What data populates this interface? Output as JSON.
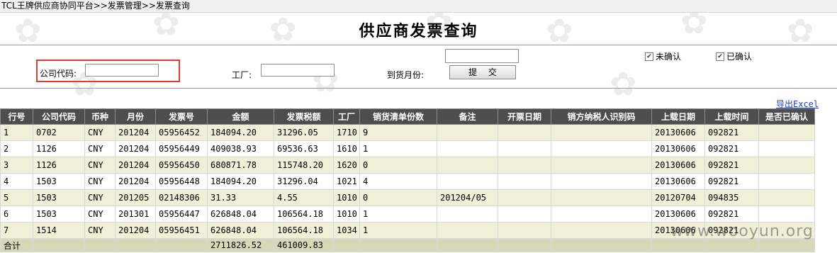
{
  "breadcrumb": "TCL王牌供应商协同平台>>发票管理>>发票查询",
  "title": "供应商发票查询",
  "form": {
    "company_code_label": "公司代码:",
    "company_code_value": "",
    "factory_label": "工厂:",
    "factory_value": "",
    "arrival_month_label": "到货月份:",
    "arrival_month_value": "",
    "submit_label": "提 交",
    "unconfirmed_label": "未确认",
    "unconfirmed_checked": true,
    "confirmed_label": "已确认",
    "confirmed_checked": true
  },
  "export_label": "导出Excel",
  "table": {
    "headers": [
      "行号",
      "公司代码",
      "币种",
      "月份",
      "发票号",
      "金额",
      "发票税额",
      "工厂",
      "销货清单份数",
      "备注",
      "开票日期",
      "销方纳税人识别码",
      "上载日期",
      "上载时间",
      "是否已确认"
    ],
    "rows": [
      [
        "1",
        "0702",
        "CNY",
        "201204",
        "05956452",
        "184094.20",
        "31296.05",
        "1710",
        "9",
        "",
        "",
        "",
        "20130606",
        "092821",
        ""
      ],
      [
        "2",
        "1126",
        "CNY",
        "201204",
        "05956449",
        "409038.93",
        "69536.63",
        "1610",
        "1",
        "",
        "",
        "",
        "20130606",
        "092821",
        ""
      ],
      [
        "3",
        "1126",
        "CNY",
        "201204",
        "05956450",
        "680871.78",
        "115748.20",
        "1620",
        "0",
        "",
        "",
        "",
        "20130606",
        "092821",
        ""
      ],
      [
        "4",
        "1503",
        "CNY",
        "201204",
        "05956448",
        "184094.20",
        "31296.04",
        "1021",
        "4",
        "",
        "",
        "",
        "20130606",
        "092821",
        ""
      ],
      [
        "5",
        "1503",
        "CNY",
        "201205",
        "02148306",
        "31.33",
        "4.55",
        "1010",
        "0",
        "201204/05",
        "",
        "",
        "20120704",
        "094835",
        ""
      ],
      [
        "6",
        "1503",
        "CNY",
        "201301",
        "05956447",
        "626848.04",
        "106564.18",
        "1010",
        "1",
        "",
        "",
        "",
        "20130606",
        "092821",
        ""
      ],
      [
        "7",
        "1514",
        "CNY",
        "201204",
        "05956451",
        "626848.04",
        "106564.18",
        "1034",
        "1",
        "",
        "",
        "",
        "20130606",
        "092821",
        ""
      ]
    ],
    "total": [
      "合计",
      "",
      "",
      "",
      "",
      "2711826.52",
      "461009.83",
      "",
      "",
      "",
      "",
      "",
      "",
      "",
      ""
    ]
  },
  "watermark": "www.wooyun.org"
}
